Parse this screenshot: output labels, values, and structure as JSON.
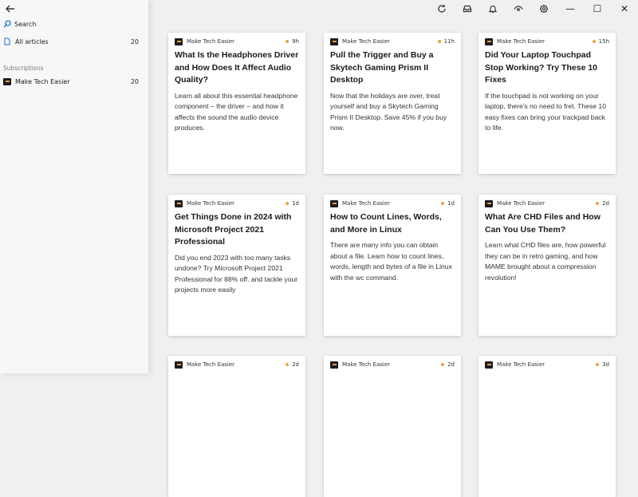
{
  "sidebar": {
    "search_label": "Search",
    "all_articles": {
      "label": "All articles",
      "count": "20"
    },
    "subscriptions_heading": "Subscriptions",
    "subscriptions": [
      {
        "label": "Make Tech Easier",
        "count": "20",
        "icon": "make-tech-easier-favicon"
      }
    ]
  },
  "toolbar": {
    "icons": [
      "refresh-icon",
      "inbox-icon",
      "bell-icon",
      "eye-icon",
      "gear-icon"
    ],
    "window_controls": {
      "minimize": "—",
      "maximize": "☐",
      "close": "✕"
    }
  },
  "colors": {
    "accent": "#1a6fd1",
    "unread_dot": "#f0a040"
  },
  "cards": [
    {
      "source": "Make Tech Easier",
      "time": "9h",
      "title": "What Is the Headphones Driver and How Does It Affect Audio Quality?",
      "summary": "Learn all about this essential headphone component – the driver – and how it affects the sound the audio device produces."
    },
    {
      "source": "Make Tech Easier",
      "time": "11h",
      "title": "Pull the Trigger and Buy a Skytech Gaming Prism II Desktop",
      "summary": "Now that the holidays are over, treat yourself and buy a Skytech Gaming Prism II Desktop. Save 45% if you buy now."
    },
    {
      "source": "Make Tech Easier",
      "time": "15h",
      "title": "Did Your Laptop Touchpad Stop Working? Try These 10 Fixes",
      "summary": "If the touchpad is not working on your laptop, there's no need to fret. These 10 easy fixes can bring your trackpad back to life."
    },
    {
      "source": "Make Tech Easier",
      "time": "1d",
      "title": "Get Things Done in 2024 with Microsoft Project 2021 Professional",
      "summary": "Did you end 2023 with too many tasks undone? Try Microsoft Project 2021 Professional for 88% off. and tackle your projects more easily"
    },
    {
      "source": "Make Tech Easier",
      "time": "1d",
      "title": "How to Count Lines, Words, and More in Linux",
      "summary": "There are many info you can obtain about a file. Learn how to count lines, words, length and bytes of a file in Linux with the wc command."
    },
    {
      "source": "Make Tech Easier",
      "time": "2d",
      "title": "What Are CHD Files and How Can You Use Them?",
      "summary": "Learn what CHD files are, how powerful they can be in retro gaming, and how MAME brought about a compression revolution!"
    },
    {
      "source": "Make Tech Easier",
      "time": "2d",
      "title": "",
      "summary": ""
    },
    {
      "source": "Make Tech Easier",
      "time": "2d",
      "title": "",
      "summary": ""
    },
    {
      "source": "Make Tech Easier",
      "time": "3d",
      "title": "",
      "summary": ""
    }
  ]
}
